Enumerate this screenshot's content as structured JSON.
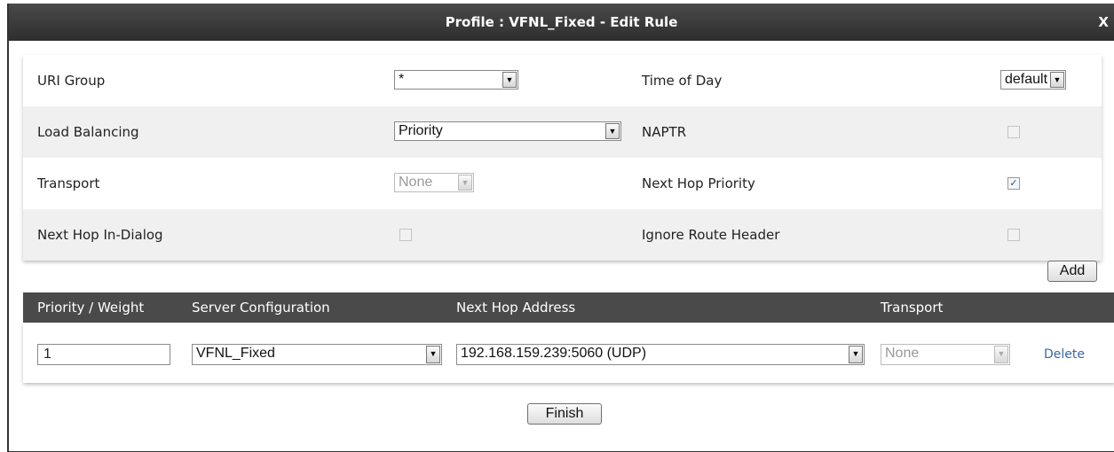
{
  "dialog": {
    "title": "Profile : VFNL_Fixed - Edit Rule",
    "close_label": "X"
  },
  "form": {
    "uri_group_label": "URI Group",
    "uri_group_value": "*",
    "time_of_day_label": "Time of Day",
    "time_of_day_value": "default",
    "load_balancing_label": "Load Balancing",
    "load_balancing_value": "Priority",
    "naptr_label": "NAPTR",
    "naptr_checked": false,
    "transport_label": "Transport",
    "transport_value": "None",
    "next_hop_priority_label": "Next Hop Priority",
    "next_hop_priority_checked": true,
    "next_hop_in_dialog_label": "Next Hop In-Dialog",
    "next_hop_in_dialog_checked": false,
    "ignore_route_header_label": "Ignore Route Header",
    "ignore_route_header_checked": false,
    "add_label": "Add"
  },
  "next_hops": {
    "columns": [
      "Priority / Weight",
      "Server Configuration",
      "Next Hop Address",
      "Transport"
    ],
    "rows": [
      {
        "priority_weight": "1",
        "server_configuration": "VFNL_Fixed",
        "next_hop_address": "192.168.159.239:5060 (UDP)",
        "transport": "None",
        "delete_label": "Delete"
      }
    ]
  },
  "footer": {
    "finish_label": "Finish"
  },
  "icons": {
    "dropdown": "chevron-down-icon",
    "checkmark": "checkmark-icon"
  }
}
